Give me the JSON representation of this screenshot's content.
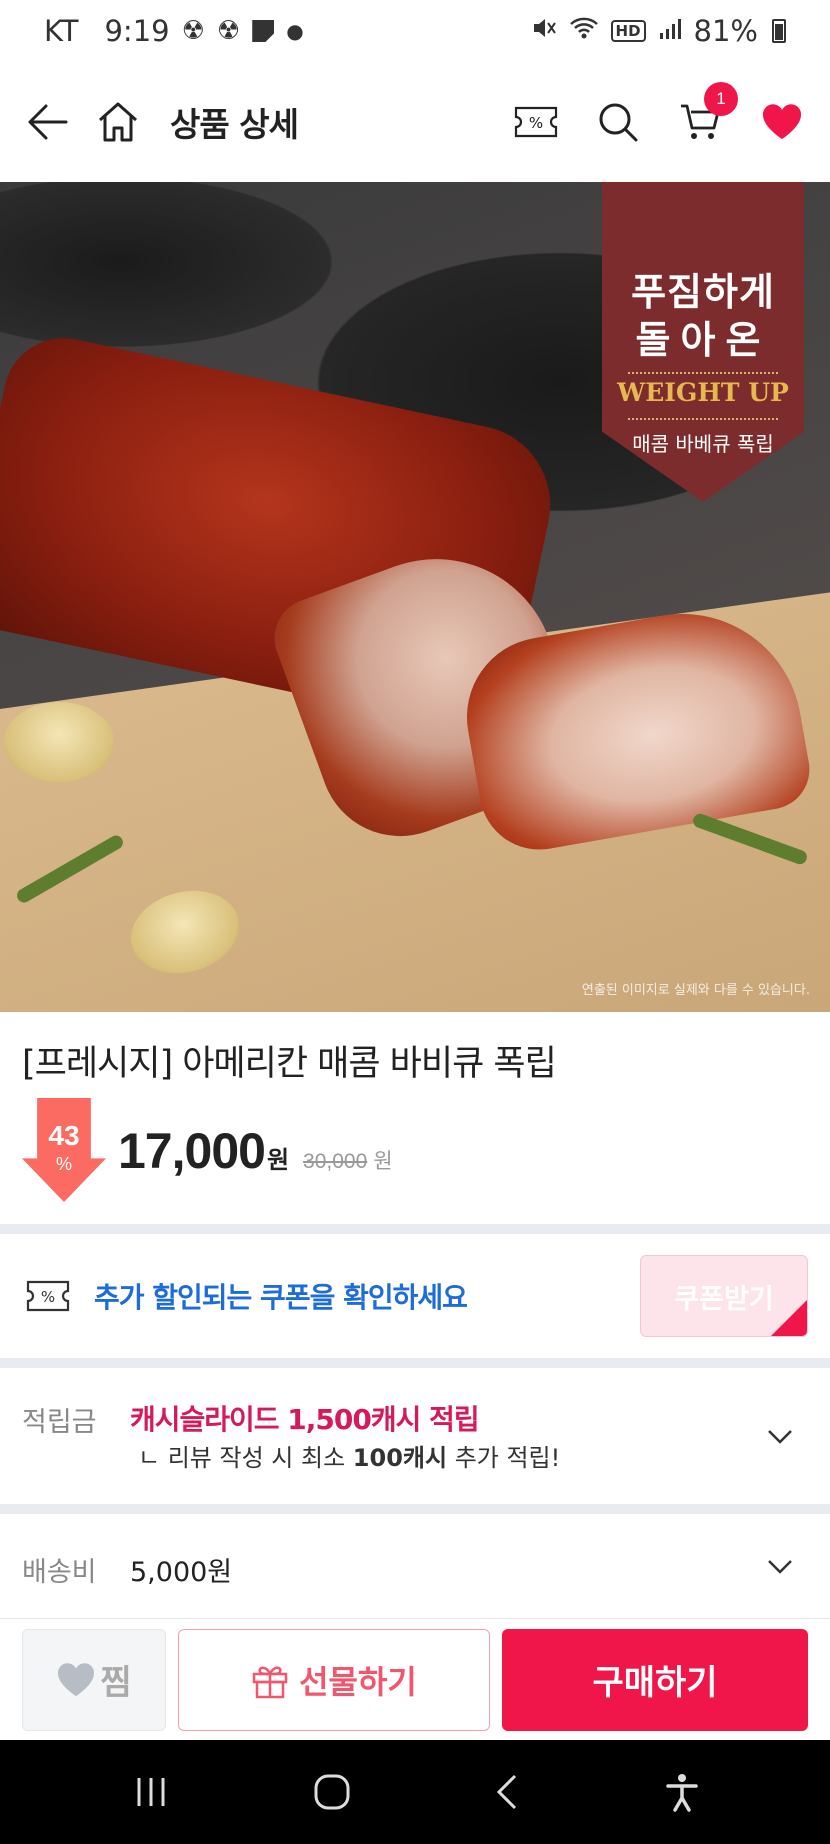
{
  "status_bar": {
    "carrier": "KT",
    "time": "9:19",
    "battery": "81%"
  },
  "header": {
    "title": "상품 상세",
    "cart_count": "1"
  },
  "product_image": {
    "ribbon_line1": "푸짐하게",
    "ribbon_line2": "돌아온",
    "ribbon_weight": "WEIGHT UP",
    "ribbon_sub": "매콤 바베큐 폭립",
    "caption": "연출된 이미지로 실제와 다를 수 있습니다."
  },
  "product": {
    "name": "[프레시지] 아메리칸 매콤 바비큐 폭립",
    "discount_num": "43",
    "discount_pct": "%",
    "price": "17,000",
    "price_unit": "원",
    "original_price": "30,000",
    "original_unit": "원"
  },
  "coupon": {
    "text": "추가 할인되는 쿠폰을 확인하세요",
    "button": "쿠폰받기"
  },
  "points": {
    "label": "적립금",
    "main": "캐시슬라이드 1,500캐시 적립",
    "sub_prefix": "ㄴ 리뷰 작성 시 최소 ",
    "sub_bold": "100캐시",
    "sub_suffix": " 추가 적립!"
  },
  "shipping": {
    "label": "배송비",
    "value": "5,000원"
  },
  "actions": {
    "wish": "찜",
    "gift": "선물하기",
    "buy": "구매하기"
  },
  "colors": {
    "accent": "#f0164a",
    "coupon_blue": "#1e6cd8",
    "discount": "#fb6b62",
    "ribbon": "#7c2c2c"
  }
}
